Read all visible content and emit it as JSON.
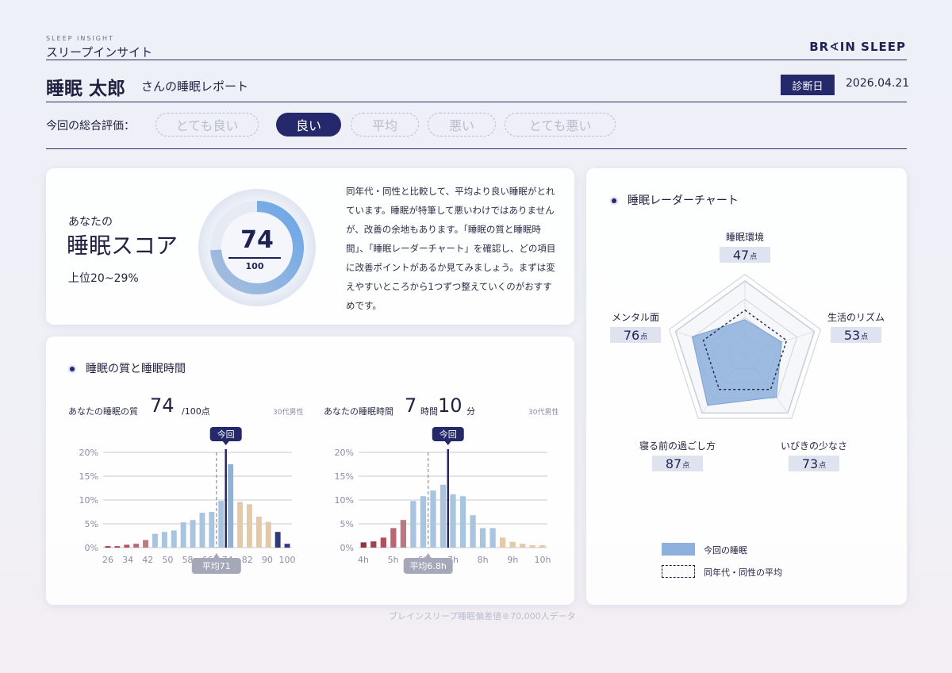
{
  "header": {
    "brand_sub": "SLEEP INSIGHT",
    "title": "スリープインサイト",
    "logo": "BR∢IN SLEEP"
  },
  "patient": {
    "name": "睡眠 太郎",
    "suffix": "さんの睡眠レポート",
    "date_label": "診断日",
    "date": "2026.04.21"
  },
  "rating": {
    "label": "今回の総合評価：",
    "options": [
      "とても良い",
      "良い",
      "平均",
      "悪い",
      "とても悪い"
    ],
    "selected": "良い"
  },
  "score_card": {
    "label_top": "あなたの",
    "label_main": "睡眠スコア",
    "rank": "上位20~29%",
    "score": "74",
    "max": "100",
    "score_fraction": 0.74,
    "description": "同年代・同性と比較して、平均より良い睡眠がとれています。睡眠が特筆して悪いわけではありませんが、改善の余地もあります。「睡眠の質と睡眠時間」、「睡眠レーダーチャート」を確認し、どの項目に改善ポイントがあるか見てみましょう。まずは変えやすいところから1つずつ整えていくのがおすすめです。"
  },
  "quality_card": {
    "title": "睡眠の質と睡眠時間",
    "quality": {
      "label": "あなたの睡眠の質",
      "value": "74",
      "unit": "/100点",
      "note": "30代男性"
    },
    "duration": {
      "label": "あなたの睡眠時間",
      "hours": "7",
      "hours_unit": "時間",
      "minutes": "10",
      "minutes_unit": "分",
      "note": "30代男性"
    }
  },
  "chart_data": [
    {
      "type": "bar",
      "title": "",
      "x_ticks": [
        "26",
        "34",
        "42",
        "50",
        "58",
        "66",
        "74",
        "82",
        "90",
        "100"
      ],
      "y_ticks": [
        "0%",
        "5%",
        "10%",
        "15%",
        "20%"
      ],
      "ylim": [
        0,
        20
      ],
      "values": [
        0.3,
        0.3,
        0.6,
        0.8,
        1.6,
        2.9,
        3.3,
        3.6,
        5.3,
        5.8,
        7.3,
        7.5,
        9.8,
        17.5,
        9.6,
        9.1,
        6.5,
        5.4,
        3.3,
        0.8
      ],
      "bar_colors": [
        "#9c2d3f",
        "#a5404c",
        "#b0525e",
        "#b76873",
        "#b97a86",
        "#a9c4de",
        "#a9c4de",
        "#a9c4de",
        "#a9c4de",
        "#a9c4de",
        "#a9c4de",
        "#a9c4de",
        "#a9c4de",
        "#8fb2d6",
        "#e5c9a6",
        "#e5c9a6",
        "#e5c9a6",
        "#e5c9a6",
        "#2f3a78",
        "#2f3a78"
      ],
      "current_index": 13,
      "average_index": 12,
      "current_label": "今回",
      "average_label": "平均71"
    },
    {
      "type": "bar",
      "title": "",
      "x_ticks": [
        "4h",
        "5h",
        "6h",
        "7h",
        "8h",
        "9h",
        "10h"
      ],
      "y_ticks": [
        "0%",
        "5%",
        "10%",
        "15%",
        "20%"
      ],
      "ylim": [
        0,
        20
      ],
      "values": [
        1.1,
        1.3,
        2.1,
        4.1,
        5.8,
        9.8,
        10.8,
        12.0,
        13.2,
        11.2,
        10.8,
        6.8,
        4.1,
        4.1,
        2.1,
        1.2,
        0.8,
        0.5,
        0.5
      ],
      "bar_colors": [
        "#9c2d3f",
        "#a5404c",
        "#b0525e",
        "#b76873",
        "#b97a86",
        "#a9c4de",
        "#a9c4de",
        "#a9c4de",
        "#a9c4de",
        "#a9c4de",
        "#a9c4de",
        "#a9c4de",
        "#a9c4de",
        "#a9c4de",
        "#e5c9a6",
        "#e5c9a6",
        "#e5c9a6",
        "#e5c9a6",
        "#e5c9a6"
      ],
      "current_index": 9,
      "average_index": 7,
      "current_label": "今回",
      "average_label": "平均6.8h"
    },
    {
      "type": "radar",
      "title": "",
      "axes": [
        "睡眠環境",
        "生活のリズム",
        "いびきの少なさ",
        "寝る前の過ごし方",
        "メンタル面"
      ],
      "series": [
        {
          "name": "今回の睡眠",
          "values": [
            47,
            53,
            73,
            87,
            76
          ]
        },
        {
          "name": "同年代・同性の平均",
          "values": [
            60,
            60,
            60,
            60,
            60
          ]
        }
      ],
      "range": [
        0,
        100
      ]
    }
  ],
  "radar_card": {
    "title": "睡眠レーダーチャート",
    "items": [
      {
        "label": "睡眠環境",
        "value": "47",
        "unit": "点"
      },
      {
        "label": "生活のリズム",
        "value": "53",
        "unit": "点"
      },
      {
        "label": "いびきの少なさ",
        "value": "73",
        "unit": "点"
      },
      {
        "label": "寝る前の過ごし方",
        "value": "87",
        "unit": "点"
      },
      {
        "label": "メンタル面",
        "value": "76",
        "unit": "点"
      }
    ],
    "legend": [
      {
        "label": "今回の睡眠",
        "color": "#8db0dc"
      },
      {
        "label": "同年代・同性の平均",
        "color": "#1f2140"
      }
    ]
  },
  "footer": {
    "source": "ブレインスリープ睡眠偏差値®70,000人データ"
  }
}
